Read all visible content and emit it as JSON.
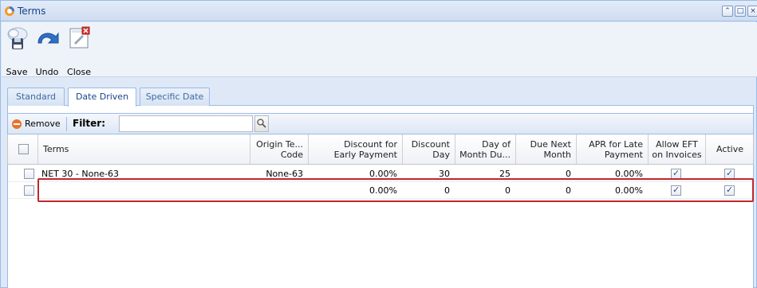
{
  "window": {
    "title": "Terms",
    "controls": [
      "⌃",
      "□",
      "×"
    ]
  },
  "toolbar": {
    "buttons": [
      {
        "label": "Save",
        "icon": "save-icon"
      },
      {
        "label": "Undo",
        "icon": "undo-icon"
      },
      {
        "label": "Close",
        "icon": "close-icon"
      }
    ]
  },
  "tabs": [
    {
      "label": "Standard",
      "active": false
    },
    {
      "label": "Date Driven",
      "active": true
    },
    {
      "label": "Specific Date",
      "active": false
    }
  ],
  "grid_toolbar": {
    "remove_label": "Remove",
    "filter_label": "Filter:",
    "filter_value": ""
  },
  "grid": {
    "columns": [
      "Terms",
      "Origin Te...\nCode",
      "Discount for\nEarly Payment",
      "Discount\nDay",
      "Day of\nMonth Du...",
      "Due Next\nMonth",
      "APR for Late\nPayment",
      "Allow EFT\non Invoices",
      "Active"
    ],
    "rows": [
      {
        "terms": "NET 30 - None-63",
        "origin": "None-63",
        "discount": "0.00%",
        "discount_day": "30",
        "day_of_month": "25",
        "due_next": "0",
        "apr": "0.00%",
        "allow_eft": true,
        "active": true
      },
      {
        "terms": "",
        "origin": "",
        "discount": "0.00%",
        "discount_day": "0",
        "day_of_month": "0",
        "due_next": "0",
        "apr": "0.00%",
        "allow_eft": true,
        "active": true
      }
    ]
  },
  "colors": {
    "accent": "#15428b",
    "highlight": "#c0272d",
    "remove": "#e8742a"
  }
}
